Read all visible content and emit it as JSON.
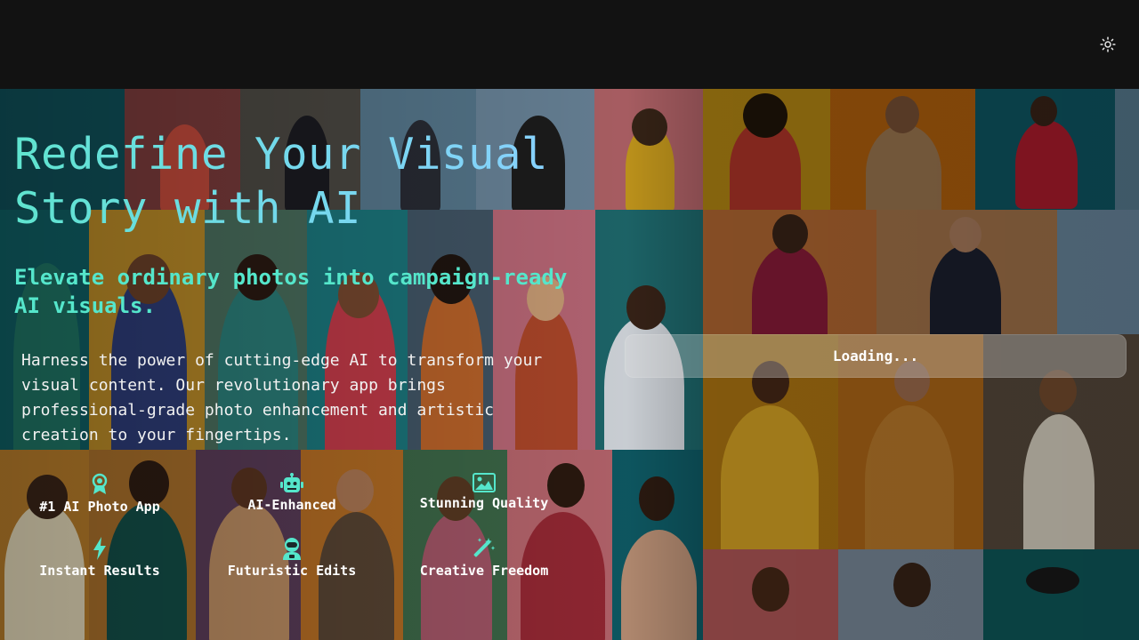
{
  "header": {
    "theme_toggle_icon": "sun-icon"
  },
  "hero": {
    "title_line1": "Redefine Your Visual",
    "title_line2": "Story with AI",
    "subtitle": "Elevate ordinary photos into campaign-ready AI visuals.",
    "description": "Harness the power of cutting-edge AI to transform your visual content. Our revolutionary app brings professional-grade photo enhancement and artistic creation to your fingertips."
  },
  "features": [
    {
      "label": "#1 AI Photo App",
      "icon": "award-icon"
    },
    {
      "label": "AI-Enhanced",
      "icon": "robot-icon"
    },
    {
      "label": "Stunning Quality",
      "icon": "image-icon"
    },
    {
      "label": "Instant Results",
      "icon": "lightning-icon"
    },
    {
      "label": "Futuristic Edits",
      "icon": "user-astronaut-icon"
    },
    {
      "label": "Creative Freedom",
      "icon": "magic-wand-icon"
    }
  ],
  "loading": {
    "text": "Loading..."
  },
  "colors": {
    "accent": "#55e6cb",
    "title_gradient_start": "#5fe4cf",
    "title_gradient_end": "#8ad0ff",
    "header_bg": "#121212"
  }
}
